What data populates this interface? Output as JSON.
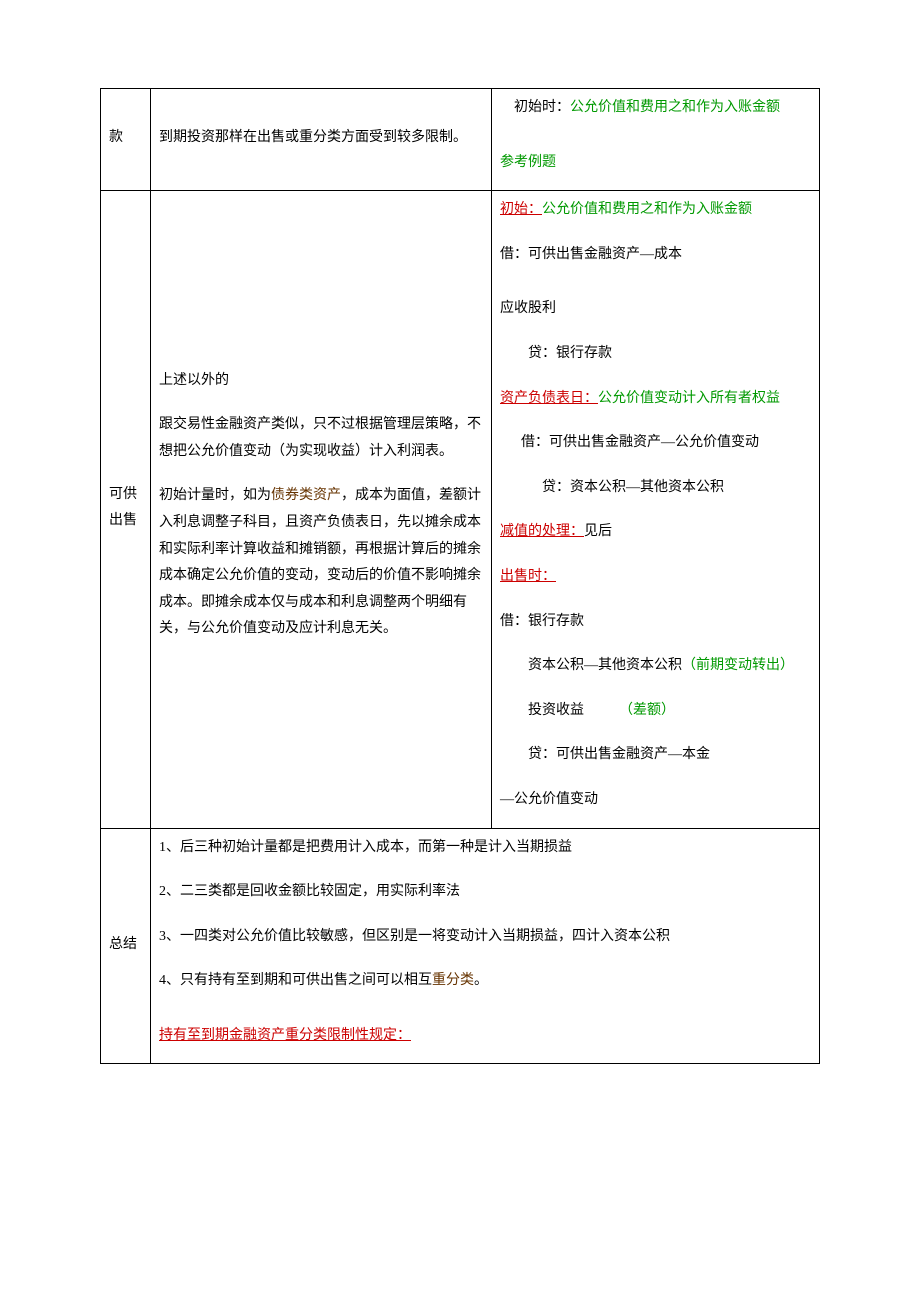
{
  "row1": {
    "col1": "款",
    "col2": "到期投资那样在出售或重分类方面受到较多限制。",
    "col3": {
      "p1a": "　初始时：",
      "p1b": "公允价值和费用之和作为入账金额",
      "p2": "参考例题"
    }
  },
  "row2": {
    "col1": "可供出售",
    "col2": {
      "p1": "上述以外的",
      "p2": "跟交易性金融资产类似，只不过根据管理层策略，不想把公允价值变动（为实现收益）计入利润表。",
      "p3a": "初始计量时，如为",
      "p3b": "债券类资产",
      "p3c": "，成本为面值，差额计入利息调整子科目，且资产负债表日，先以摊余成本和实际利率计算收益和摊销额，再根据计算后的摊余成本确定公允价值的变动，变动后的价值不影响摊余成本。即摊余成本仅与成本和利息调整两个明细有关，与公允价值变动及应计利息无关。"
    },
    "col3": {
      "p1a": "初始：",
      "p1b": "公允价值和费用之和作为入账金额",
      "p2": "借：可供出售金融资产—成本",
      "p3": "应收股利",
      "p4": "贷：银行存款",
      "p5a": "资产负债表日：",
      "p5b": "公允价值变动计入所有者权益",
      "p6": "借：可供出售金融资产—公允价值变动",
      "p7": "贷：资本公积—其他资本公积",
      "p8a": "减值的处理：",
      "p8b": "见后",
      "p9": "出售时：",
      "p10": "借：银行存款",
      "p11a": "资本公积—其他资本公积",
      "p11b": "（前期变动转出）",
      "p12a": "投资收益",
      "p12b": "（差额）",
      "p13": "贷：可供出售金融资产—本金",
      "p14": "—公允价值变动"
    }
  },
  "row3": {
    "col1": "总结",
    "col2": {
      "p1": "1、后三种初始计量都是把费用计入成本，而第一种是计入当期损益",
      "p2": "2、二三类都是回收金额比较固定，用实际利率法",
      "p3": "3、一四类对公允价值比较敏感，但区别是一将变动计入当期损益，四计入资本公积",
      "p4a": "4、只有持有至到期和可供出售之间可以相互",
      "p4b": "重分类",
      "p4c": "。",
      "p5": "持有至到期金融资产重分类限制性规定："
    }
  }
}
